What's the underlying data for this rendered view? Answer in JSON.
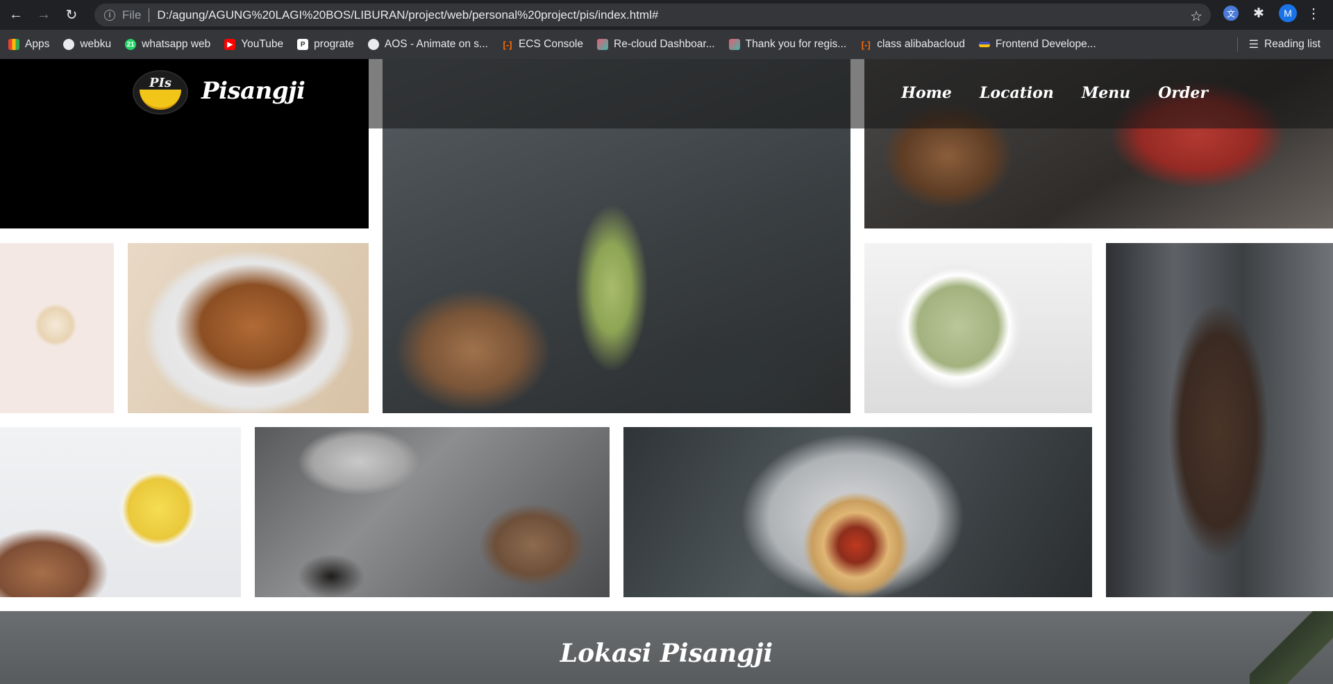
{
  "browser": {
    "url_scheme": "File",
    "url": "D:/agung/AGUNG%20LAGI%20BOS/LIBURAN/project/web/personal%20project/pis/index.html#",
    "avatar_letter": "M",
    "bookmarks": [
      {
        "label": "Apps",
        "icon": "apps-grid-icon",
        "color": "#ea4335"
      },
      {
        "label": "webku",
        "icon": "globe-icon",
        "color": "#5f6368"
      },
      {
        "label": "whatsapp web",
        "icon": "whatsapp-icon",
        "color": "#25d366"
      },
      {
        "label": "YouTube",
        "icon": "youtube-icon",
        "color": "#ff0000"
      },
      {
        "label": "prograte",
        "icon": "prograte-icon",
        "color": "#ffffff"
      },
      {
        "label": "AOS - Animate on s...",
        "icon": "globe-icon",
        "color": "#5f6368"
      },
      {
        "label": "ECS Console",
        "icon": "alibaba-icon",
        "color": "#ff6a00"
      },
      {
        "label": "Re-cloud Dashboar...",
        "icon": "recloud-icon",
        "color": "#e85d75"
      },
      {
        "label": "Thank you for regis...",
        "icon": "recloud-icon",
        "color": "#e85d75"
      },
      {
        "label": "class alibabacloud",
        "icon": "alibaba-icon",
        "color": "#ff6a00"
      },
      {
        "label": "Frontend Develope...",
        "icon": "frontend-icon",
        "color": "#3f51b5"
      }
    ],
    "reading_list": "Reading list"
  },
  "site": {
    "logo_text": "PIs",
    "brand": "Pisangji",
    "nav": [
      "Home",
      "Location",
      "Menu",
      "Order"
    ],
    "lokasi_title": "Lokasi Pisangji"
  },
  "colors": {
    "browser_dark": "#202124",
    "bookmark_bar": "#35363a",
    "banana_yellow": "#f2c618"
  }
}
